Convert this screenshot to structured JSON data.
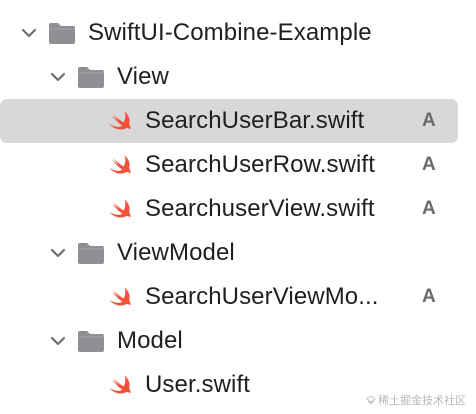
{
  "tree": {
    "root": {
      "label": "SwiftUI-Combine-Example",
      "icon": "folder-icon",
      "expanded": true
    },
    "view_folder": {
      "label": "View",
      "icon": "folder-icon",
      "expanded": true,
      "files": [
        {
          "label": "SearchUserBar.swift",
          "badge": "A",
          "icon": "swift-file-icon",
          "selected": true
        },
        {
          "label": "SearchUserRow.swift",
          "badge": "A",
          "icon": "swift-file-icon",
          "selected": false
        },
        {
          "label": "SearchuserView.swift",
          "badge": "A",
          "icon": "swift-file-icon",
          "selected": false
        }
      ]
    },
    "viewmodel_folder": {
      "label": "ViewModel",
      "icon": "folder-icon",
      "expanded": true,
      "files": [
        {
          "label": "SearchUserViewMo...",
          "badge": "A",
          "icon": "swift-file-icon",
          "selected": false
        }
      ]
    },
    "model_folder": {
      "label": "Model",
      "icon": "folder-icon",
      "expanded": true,
      "files": [
        {
          "label": "User.swift",
          "badge": "",
          "icon": "swift-file-icon",
          "selected": false
        }
      ]
    }
  },
  "watermark": {
    "text": "稀土掘金技术社区"
  },
  "colors": {
    "swift_orange": "#f05138",
    "folder_gray": "#8e8e93",
    "selection_bg": "#d8d8da",
    "badge_gray": "#6b6b6b"
  }
}
